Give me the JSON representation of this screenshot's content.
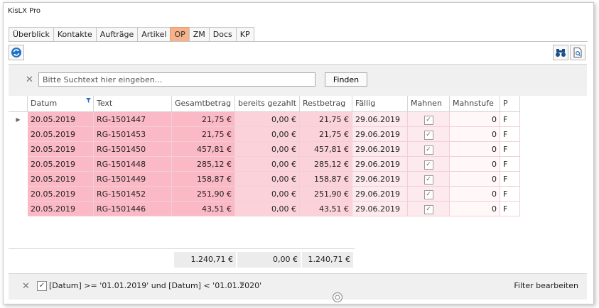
{
  "window": {
    "title": "KisLX Pro"
  },
  "tabs": [
    {
      "label": "Überblick",
      "active": false
    },
    {
      "label": "Kontakte",
      "active": false
    },
    {
      "label": "Aufträge",
      "active": false
    },
    {
      "label": "Artikel",
      "active": false
    },
    {
      "label": "OP",
      "active": true
    },
    {
      "label": "ZM",
      "active": false
    },
    {
      "label": "Docs",
      "active": false
    },
    {
      "label": "KP",
      "active": false
    }
  ],
  "toolbar": {
    "refresh_icon": "refresh-icon",
    "binoculars_icon": "binoculars-icon",
    "zoom_icon": "zoom-page-icon"
  },
  "search": {
    "placeholder": "Bitte Suchtext hier eingeben...",
    "value": "",
    "find_label": "Finden"
  },
  "grid": {
    "columns": [
      "Datum",
      "Text",
      "Gesamtbetrag",
      "bereits gezahlt",
      "Restbetrag",
      "Fällig",
      "Mahnen",
      "Mahnstufe",
      "P"
    ],
    "rows": [
      {
        "datum": "20.05.2019",
        "text": "RG-1501447",
        "gesamt": "21,75 €",
        "gezahlt": "0,00 €",
        "rest": "21,75 €",
        "faellig": "29.06.2019",
        "mahnen": true,
        "mahnstufe": "0",
        "p": "F"
      },
      {
        "datum": "20.05.2019",
        "text": "RG-1501453",
        "gesamt": "21,75 €",
        "gezahlt": "0,00 €",
        "rest": "21,75 €",
        "faellig": "29.06.2019",
        "mahnen": true,
        "mahnstufe": "0",
        "p": "F"
      },
      {
        "datum": "20.05.2019",
        "text": "RG-1501450",
        "gesamt": "457,81 €",
        "gezahlt": "0,00 €",
        "rest": "457,81 €",
        "faellig": "29.06.2019",
        "mahnen": true,
        "mahnstufe": "0",
        "p": "F"
      },
      {
        "datum": "20.05.2019",
        "text": "RG-1501448",
        "gesamt": "285,12 €",
        "gezahlt": "0,00 €",
        "rest": "285,12 €",
        "faellig": "29.06.2019",
        "mahnen": true,
        "mahnstufe": "0",
        "p": "F"
      },
      {
        "datum": "20.05.2019",
        "text": "RG-1501449",
        "gesamt": "158,87 €",
        "gezahlt": "0,00 €",
        "rest": "158,87 €",
        "faellig": "29.06.2019",
        "mahnen": true,
        "mahnstufe": "0",
        "p": "F"
      },
      {
        "datum": "20.05.2019",
        "text": "RG-1501452",
        "gesamt": "251,90 €",
        "gezahlt": "0,00 €",
        "rest": "251,90 €",
        "faellig": "29.06.2019",
        "mahnen": true,
        "mahnstufe": "0",
        "p": "F"
      },
      {
        "datum": "20.05.2019",
        "text": "RG-1501446",
        "gesamt": "43,51 €",
        "gezahlt": "0,00 €",
        "rest": "43,51 €",
        "faellig": "29.06.2019",
        "mahnen": true,
        "mahnstufe": "0",
        "p": "F"
      }
    ],
    "totals": {
      "gesamt": "1.240,71 €",
      "gezahlt": "0,00 €",
      "rest": "1.240,71 €"
    }
  },
  "filter": {
    "enabled": true,
    "text": "[Datum] >= '01.01.2019' und [Datum] < '01.01.2020'",
    "edit_label": "Filter bearbeiten"
  },
  "colors": {
    "accent_tab": "#f7b28a",
    "row_dark": "#fbb8c5",
    "row_mid": "#fcd2da",
    "row_light": "#fdeaee",
    "row_white": "#fff7f8"
  }
}
